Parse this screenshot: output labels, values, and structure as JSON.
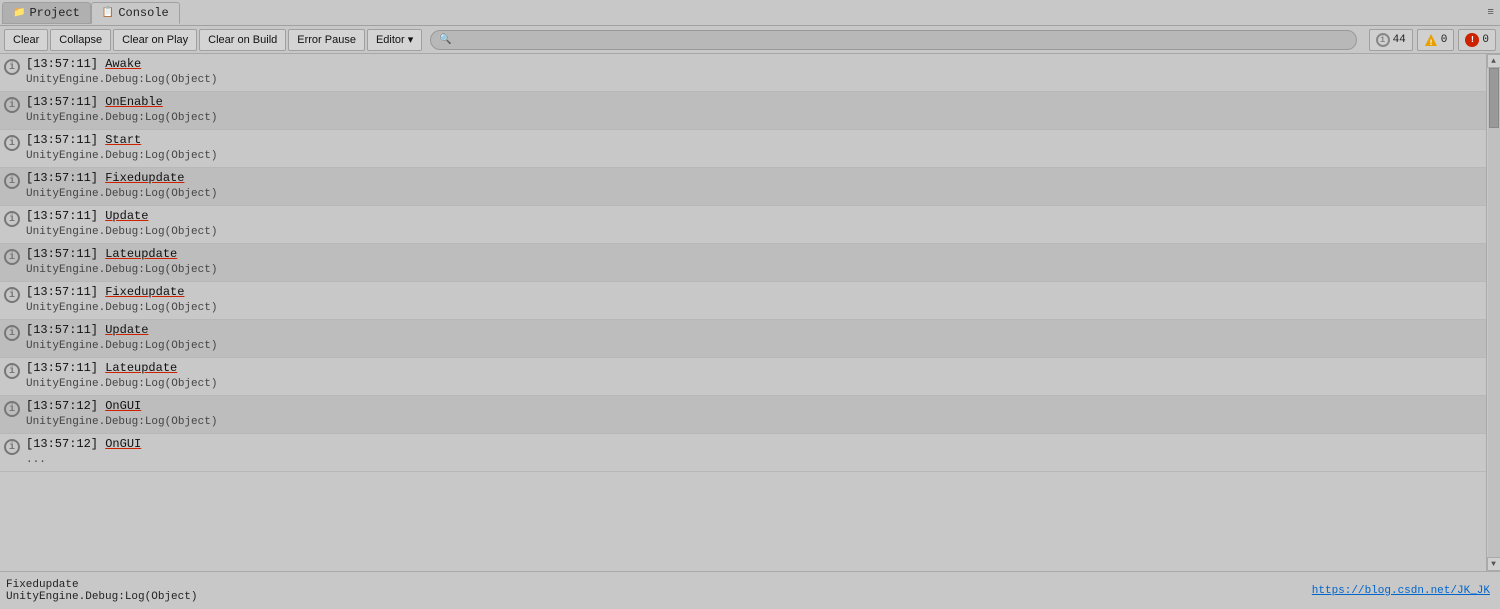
{
  "tabs": [
    {
      "id": "project",
      "label": "Project",
      "icon": "📁",
      "active": false
    },
    {
      "id": "console",
      "label": "Console",
      "icon": "📋",
      "active": true
    }
  ],
  "toolbar": {
    "clear_label": "Clear",
    "collapse_label": "Collapse",
    "clear_on_play_label": "Clear on Play",
    "clear_on_build_label": "Clear on Build",
    "error_pause_label": "Error Pause",
    "editor_label": "Editor",
    "search_placeholder": "",
    "info_count": "44",
    "warn_count": "0",
    "error_count": "0"
  },
  "log_entries": [
    {
      "timestamp": "[13:57:11]",
      "method": "Awake",
      "stack": "UnityEngine.Debug:Log(Object)"
    },
    {
      "timestamp": "[13:57:11]",
      "method": "OnEnable",
      "stack": "UnityEngine.Debug:Log(Object)"
    },
    {
      "timestamp": "[13:57:11]",
      "method": "Start",
      "stack": "UnityEngine.Debug:Log(Object)"
    },
    {
      "timestamp": "[13:57:11]",
      "method": "Fixedupdate",
      "stack": "UnityEngine.Debug:Log(Object)"
    },
    {
      "timestamp": "[13:57:11]",
      "method": "Update",
      "stack": "UnityEngine.Debug:Log(Object)"
    },
    {
      "timestamp": "[13:57:11]",
      "method": "Lateupdate",
      "stack": "UnityEngine.Debug:Log(Object)"
    },
    {
      "timestamp": "[13:57:11]",
      "method": "Fixedupdate",
      "stack": "UnityEngine.Debug:Log(Object)"
    },
    {
      "timestamp": "[13:57:11]",
      "method": "Update",
      "stack": "UnityEngine.Debug:Log(Object)"
    },
    {
      "timestamp": "[13:57:11]",
      "method": "Lateupdate",
      "stack": "UnityEngine.Debug:Log(Object)"
    },
    {
      "timestamp": "[13:57:12]",
      "method": "OnGUI",
      "stack": "UnityEngine.Debug:Log(Object)"
    },
    {
      "timestamp": "[13:57:12]",
      "method": "OnGUI",
      "stack": "..."
    }
  ],
  "status_bar": {
    "line1": "Fixedupdate",
    "line2": "UnityEngine.Debug:Log(Object)",
    "link": "https://blog.csdn.net/JK_JK"
  },
  "menu_icon": "≡"
}
